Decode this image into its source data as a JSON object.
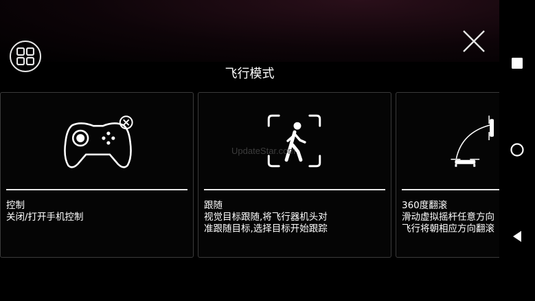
{
  "header": {
    "title": "飞行模式"
  },
  "watermark": "UpdateStar.com",
  "modes": [
    {
      "name": "控制",
      "description": "关闭/打开手机控制",
      "icon": "gamepad-icon"
    },
    {
      "name": "跟随",
      "description": "视觉目标跟随,将飞行器机头对\n准跟随目标,选择目标开始跟踪",
      "icon": "follow-person-icon"
    },
    {
      "name": "360度翻滚",
      "description": "滑动虚拟摇杆任意方向\n飞行将朝相应方向翻滚",
      "icon": "drone-flip-icon"
    }
  ],
  "colors": {
    "background": "#000000",
    "text": "#ffffff",
    "card_border": "#3b3b3b"
  }
}
